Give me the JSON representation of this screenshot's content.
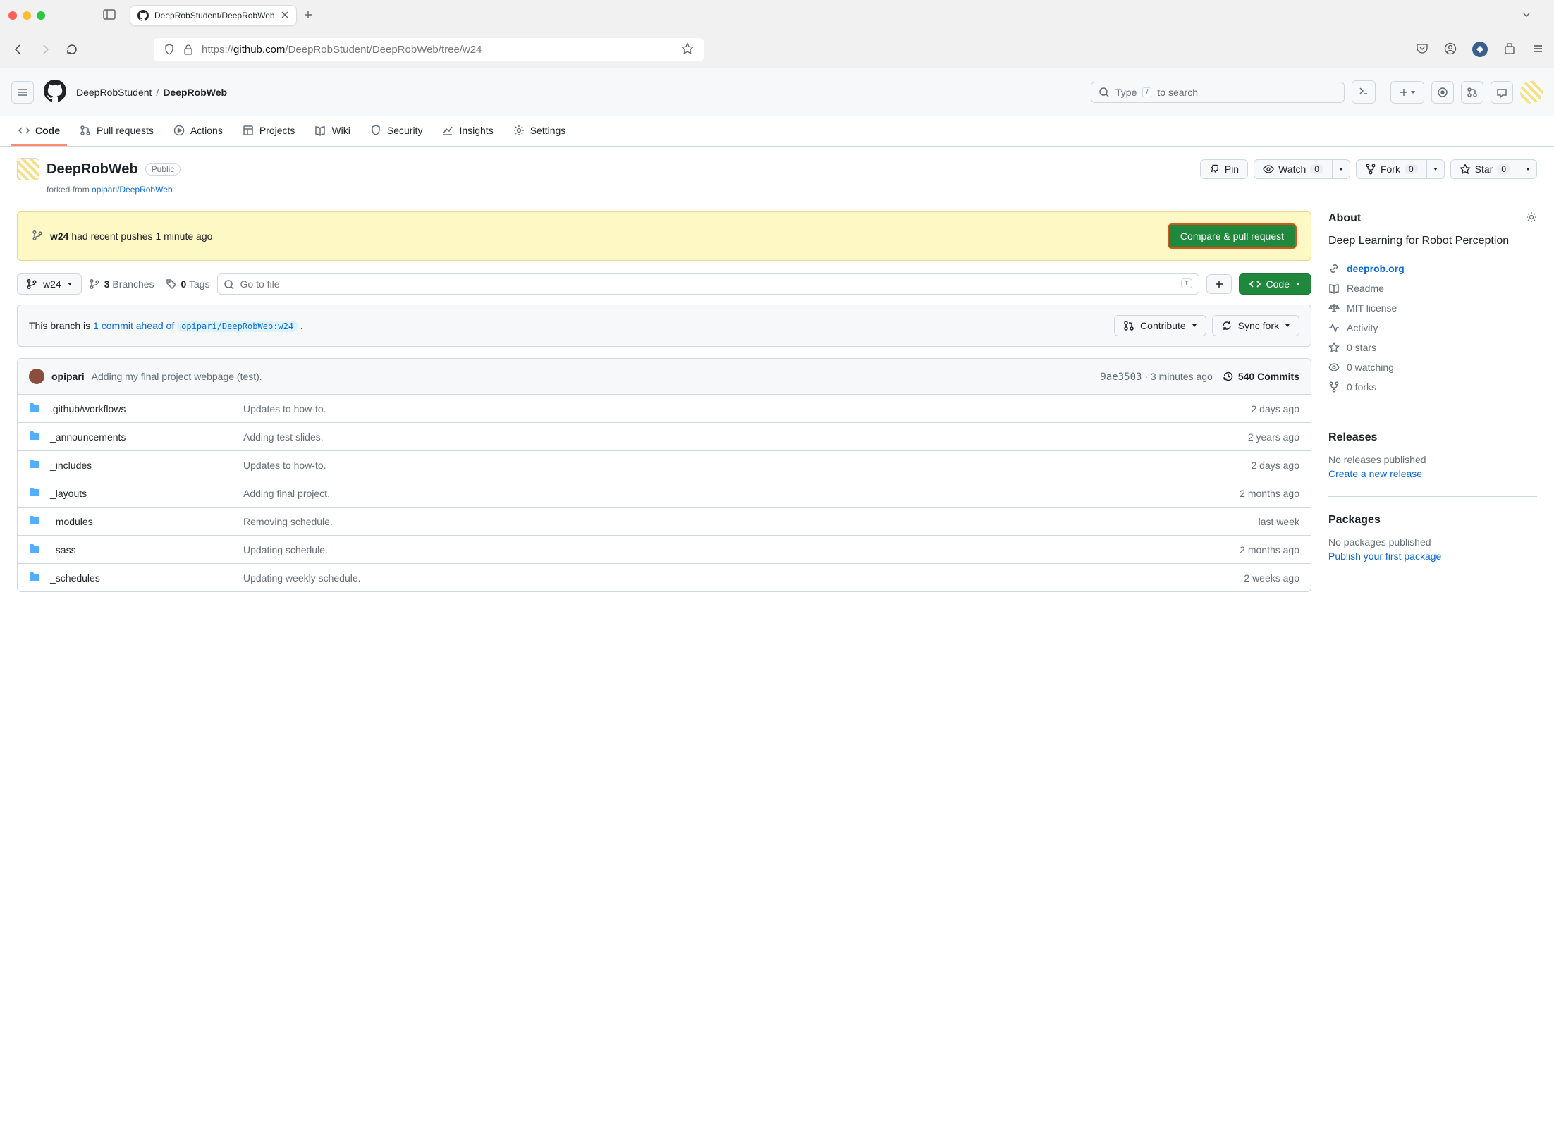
{
  "browser": {
    "tab_title": "DeepRobStudent/DeepRobWeb",
    "url_prefix": "https://",
    "url_domain": "github.com",
    "url_path": "/DeepRobStudent/DeepRobWeb/tree/w24"
  },
  "header": {
    "owner": "DeepRobStudent",
    "repo": "DeepRobWeb",
    "search_placeholder_pre": "Type",
    "search_placeholder_post": "to search",
    "slash_key": "/"
  },
  "nav": {
    "code": "Code",
    "pull_requests": "Pull requests",
    "actions": "Actions",
    "projects": "Projects",
    "wiki": "Wiki",
    "security": "Security",
    "insights": "Insights",
    "settings": "Settings"
  },
  "repo": {
    "name": "DeepRobWeb",
    "visibility": "Public",
    "forked_prefix": "forked from ",
    "forked_from": "opipari/DeepRobWeb",
    "pin": "Pin",
    "watch": "Watch",
    "watch_count": "0",
    "fork": "Fork",
    "fork_count": "0",
    "star": "Star",
    "star_count": "0"
  },
  "push_banner": {
    "branch": "w24",
    "message": "had recent pushes 1 minute ago",
    "button": "Compare & pull request"
  },
  "controls": {
    "branch": "w24",
    "branches_count": "3",
    "branches_label": "Branches",
    "tags_count": "0",
    "tags_label": "Tags",
    "go_to_file": "Go to file",
    "kbd": "t",
    "code_btn": "Code"
  },
  "compare": {
    "prefix": "This branch is ",
    "ahead": "1 commit ahead of",
    "base": "opipari/DeepRobWeb:w24",
    "suffix": ".",
    "contribute": "Contribute",
    "sync": "Sync fork"
  },
  "commit_header": {
    "author": "opipari",
    "message": "Adding my final project webpage (test).",
    "sha": "9ae3503",
    "dot": "·",
    "time": "3 minutes ago",
    "commits": "540 Commits"
  },
  "files": [
    {
      "name": ".github/workflows",
      "msg": "Updates to how-to.",
      "age": "2 days ago"
    },
    {
      "name": "_announcements",
      "msg": "Adding test slides.",
      "age": "2 years ago"
    },
    {
      "name": "_includes",
      "msg": "Updates to how-to.",
      "age": "2 days ago"
    },
    {
      "name": "_layouts",
      "msg": "Adding final project.",
      "age": "2 months ago"
    },
    {
      "name": "_modules",
      "msg": "Removing schedule.",
      "age": "last week"
    },
    {
      "name": "_sass",
      "msg": "Updating schedule.",
      "age": "2 months ago"
    },
    {
      "name": "_schedules",
      "msg": "Updating weekly schedule.",
      "age": "2 weeks ago"
    }
  ],
  "sidebar": {
    "about": "About",
    "description": "Deep Learning for Robot Perception",
    "website": "deeprob.org",
    "readme": "Readme",
    "license": "MIT license",
    "activity": "Activity",
    "stars": "0 stars",
    "watching": "0 watching",
    "forks": "0 forks",
    "releases": "Releases",
    "releases_empty": "No releases published",
    "releases_link": "Create a new release",
    "packages": "Packages",
    "packages_empty": "No packages published",
    "packages_link": "Publish your first package"
  }
}
